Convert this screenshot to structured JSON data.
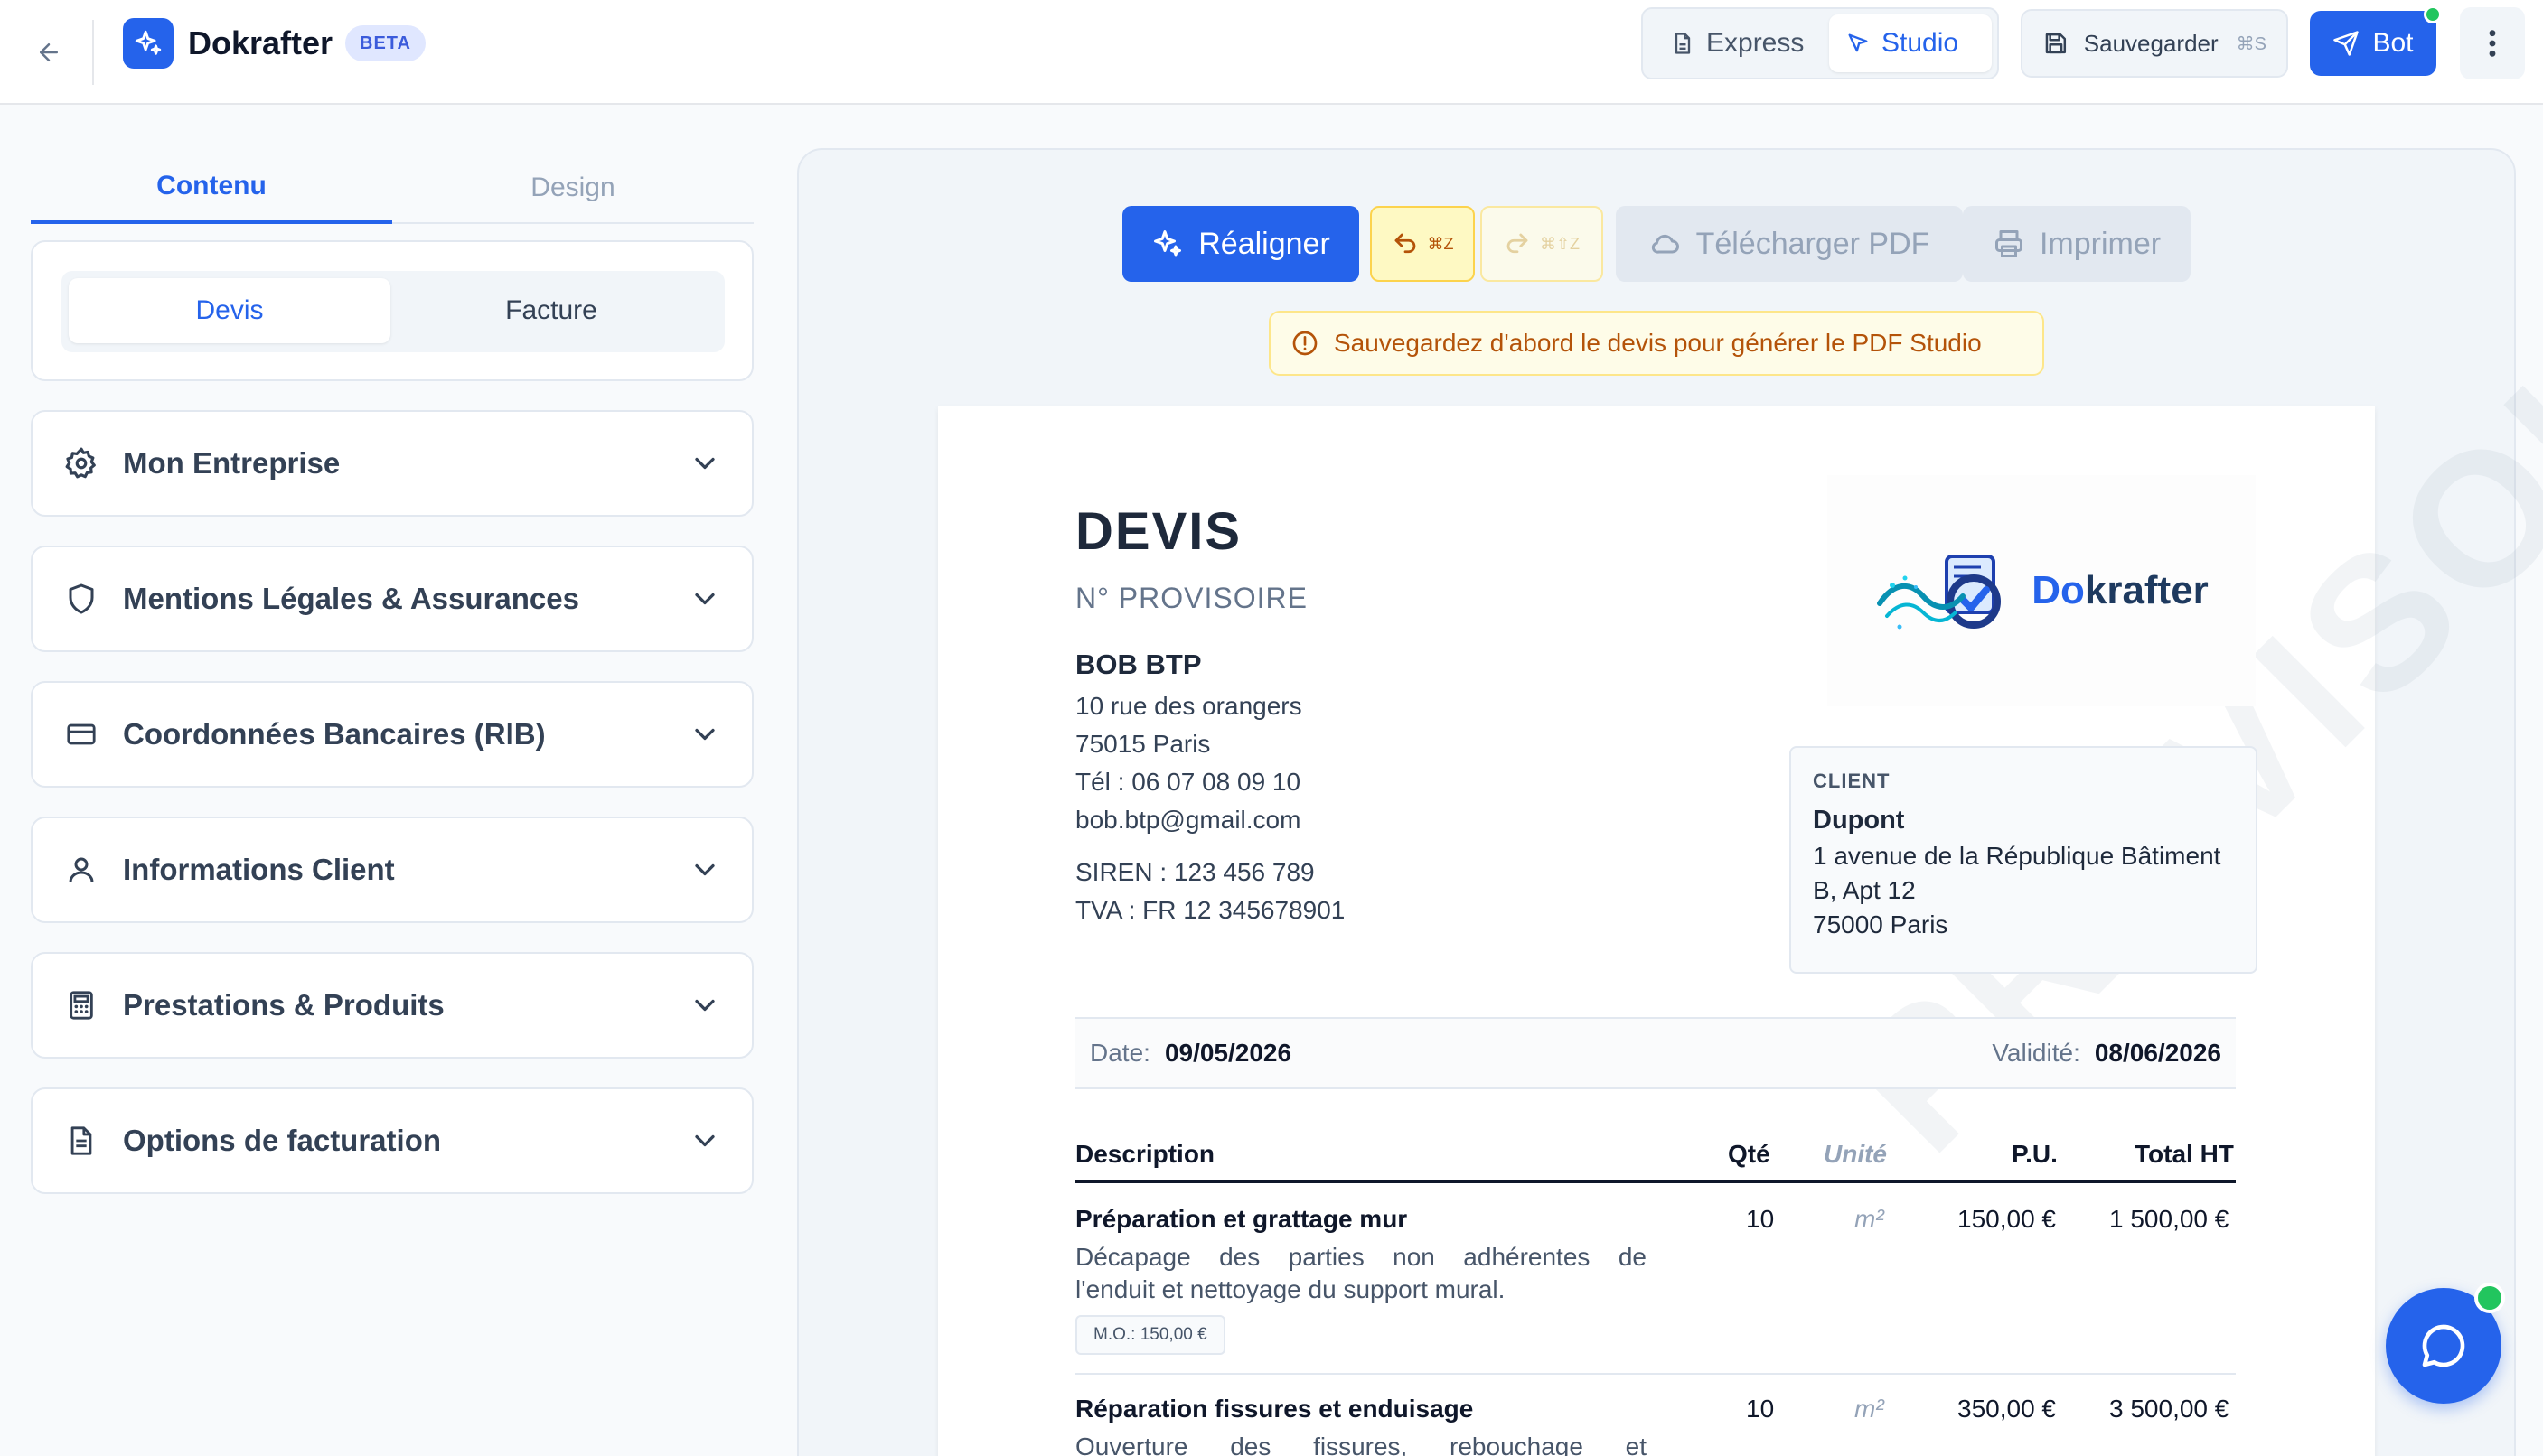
{
  "header": {
    "brand": "Dokrafter",
    "badge": "BETA",
    "modes": {
      "express": "Express",
      "studio": "Studio",
      "active": "studio"
    },
    "save_label": "Sauvegarder",
    "save_shortcut": "⌘S",
    "bot_label": "Bot"
  },
  "sidebar": {
    "tabs": [
      "Contenu",
      "Design"
    ],
    "active_tab": "Contenu",
    "doc_types": [
      "Devis",
      "Facture"
    ],
    "active_doc_type": "Devis",
    "sections": [
      {
        "label": "Mon Entreprise",
        "icon": "gear-icon"
      },
      {
        "label": "Mentions Légales & Assurances",
        "icon": "shield-icon"
      },
      {
        "label": "Coordonnées Bancaires (RIB)",
        "icon": "credit-card-icon"
      },
      {
        "label": "Informations Client",
        "icon": "user-icon"
      },
      {
        "label": "Prestations & Produits",
        "icon": "calculator-icon"
      },
      {
        "label": "Options de facturation",
        "icon": "document-icon"
      }
    ]
  },
  "preview": {
    "toolbar": {
      "realign": "Réaligner",
      "undo_shortcut": "⌘Z",
      "redo_shortcut": "⌘⇧Z",
      "download_pdf": "Télécharger PDF",
      "print": "Imprimer"
    },
    "warning": "Sauvegardez d'abord le devis pour générer le PDF Studio",
    "watermark": "PROVISOIRE",
    "document": {
      "title": "DEVIS",
      "number": "N° PROVISOIRE",
      "company": {
        "name": "BOB BTP",
        "address1": "10 rue des orangers",
        "address2": "75015 Paris",
        "phone": "Tél : 06 07 08 09 10",
        "email": "bob.btp@gmail.com",
        "siren": "SIREN : 123 456 789",
        "tva": "TVA : FR 12 345678901"
      },
      "logo": {
        "prefix": "Do",
        "suffix": "krafter"
      },
      "client": {
        "label": "CLIENT",
        "name": "Dupont",
        "address1": "1 avenue de la République Bâtiment",
        "address2": "B, Apt 12",
        "address3": "75000 Paris"
      },
      "date_label": "Date:",
      "date": "09/05/2026",
      "validity_label": "Validité:",
      "validity": "08/06/2026",
      "columns": {
        "description": "Description",
        "qty": "Qté",
        "unit": "Unité",
        "pu": "P.U.",
        "total": "Total HT"
      },
      "lines": [
        {
          "title": "Préparation et grattage mur",
          "desc1": "Décapage des parties non adhérentes de",
          "desc2": "l'enduit et nettoyage du support mural.",
          "qty": "10",
          "unit": "m²",
          "pu": "150,00 €",
          "total": "1 500,00 €",
          "badge": "M.O.: 150,00 €"
        },
        {
          "title": "Réparation fissures et enduisage",
          "desc1": "Ouverture des fissures, rebouchage et",
          "qty": "10",
          "unit": "m²",
          "pu": "350,00 €",
          "total": "3 500,00 €"
        }
      ]
    }
  },
  "colors": {
    "accent": "#2563eb",
    "warning": "#b45309",
    "online": "#22c55e"
  }
}
